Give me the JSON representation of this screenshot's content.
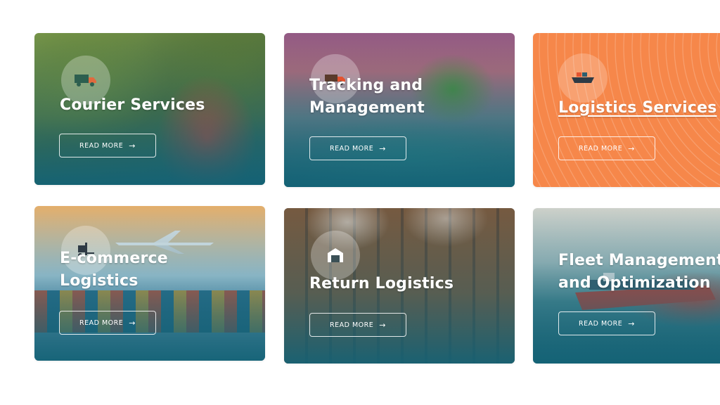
{
  "cards": [
    {
      "title_lines": [
        "Courier Services"
      ],
      "button_label": "READ MORE",
      "button_arrow": "→",
      "icon": "truck-icon"
    },
    {
      "title_lines": [
        "Tracking and",
        "Management"
      ],
      "button_label": "READ MORE",
      "button_arrow": "→",
      "icon": "delivery-truck-icon"
    },
    {
      "title_lines": [
        "Logistics Services"
      ],
      "button_label": "READ MORE",
      "button_arrow": "→",
      "icon": "cargo-ship-icon",
      "accent_color": "#f6874a"
    },
    {
      "title_lines": [
        "E-commerce",
        "Logistics"
      ],
      "button_label": "READ MORE",
      "button_arrow": "→",
      "icon": "forklift-icon"
    },
    {
      "title_lines": [
        "Return Logistics"
      ],
      "button_label": "READ MORE",
      "button_arrow": "→",
      "icon": "warehouse-icon"
    },
    {
      "title_lines": [
        "Fleet Management",
        "and Optimization"
      ],
      "button_label": "READ MORE",
      "button_arrow": "→",
      "icon": "ship-icon"
    }
  ]
}
